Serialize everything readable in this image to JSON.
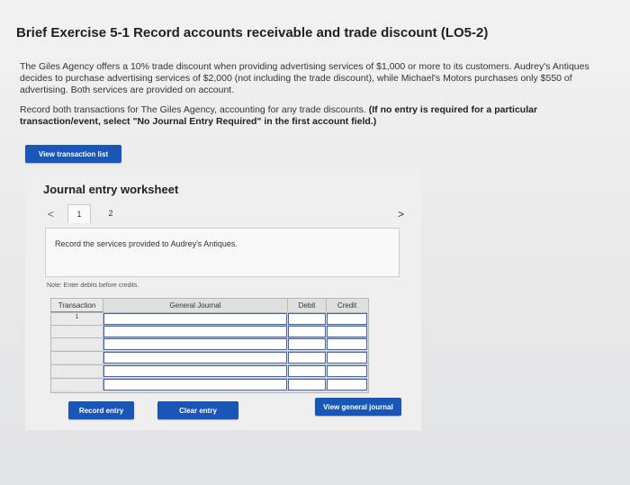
{
  "header": {
    "title": "Brief Exercise 5-1 Record accounts receivable and trade discount (LO5-2)"
  },
  "problem": {
    "paragraph1": "The Giles Agency offers a 10% trade discount when providing advertising services of $1,000 or more to its customers. Audrey's Antiques decides to purchase advertising services of $2,000 (not including the trade discount), while Michael's Motors purchases only $550 of advertising. Both services are provided on account.",
    "paragraph2_text": "Record both transactions for The Giles Agency, accounting for any trade discounts.",
    "paragraph2_bold": "(If no entry is required for a particular transaction/event, select \"No Journal Entry Required\" in the first account field.)"
  },
  "buttons": {
    "view_transaction_list": "View transaction list",
    "record_entry": "Record entry",
    "clear_entry": "Clear entry",
    "view_general_journal": "View general journal"
  },
  "worksheet": {
    "title": "Journal entry worksheet",
    "pager": {
      "prev": "<",
      "next": ">",
      "pages": [
        "1",
        "2"
      ],
      "active": "1"
    },
    "instruction": "Record the services provided to Audrey's Antiques.",
    "note": "Note: Enter debits before credits."
  },
  "journal_table": {
    "headers": {
      "transaction": "Transaction",
      "general_journal": "General Journal",
      "debit": "Debit",
      "credit": "Credit"
    },
    "rows": [
      {
        "transaction": "1"
      },
      {
        "transaction": ""
      },
      {
        "transaction": ""
      },
      {
        "transaction": ""
      },
      {
        "transaction": ""
      },
      {
        "transaction": ""
      }
    ]
  },
  "colors": {
    "button_blue": "#1a56b8",
    "input_border": "#3f66b5"
  }
}
